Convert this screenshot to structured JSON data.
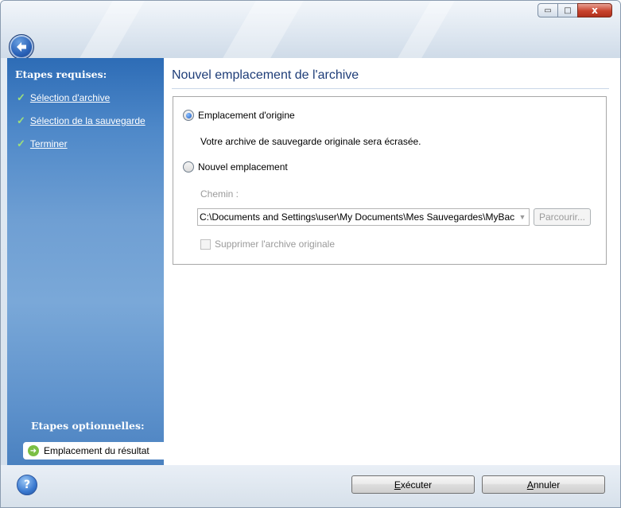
{
  "window": {
    "controls": {
      "minimize": "▭",
      "maximize": "□",
      "close": "x"
    }
  },
  "sidebar": {
    "required_heading": "Etapes requises:",
    "required_items": [
      {
        "label": "Sélection d'archive"
      },
      {
        "label": "Sélection de la sauvegarde"
      },
      {
        "label": "Terminer"
      }
    ],
    "optional_heading": "Etapes optionnelles:",
    "optional_items": [
      {
        "label": "Emplacement du résultat"
      }
    ]
  },
  "main": {
    "title": "Nouvel emplacement de l'archive",
    "options": {
      "original": {
        "label": "Emplacement d'origine",
        "selected": true,
        "description": "Votre archive de sauvegarde originale sera écrasée."
      },
      "new": {
        "label": "Nouvel emplacement",
        "selected": false
      }
    },
    "path_label": "Chemin :",
    "path_value": "C:\\Documents and Settings\\user\\My Documents\\Mes Sauvegardes\\MyBac",
    "browse_label": "Parcourir...",
    "delete_original_label": "Supprimer l'archive originale"
  },
  "footer": {
    "help": "?",
    "execute": {
      "first": "E",
      "rest": "xécuter"
    },
    "cancel": {
      "first": "A",
      "rest": "nnuler"
    }
  },
  "colors": {
    "accent": "#2d6cb6",
    "title_text": "#1e3d78",
    "check": "#9ee07a"
  }
}
